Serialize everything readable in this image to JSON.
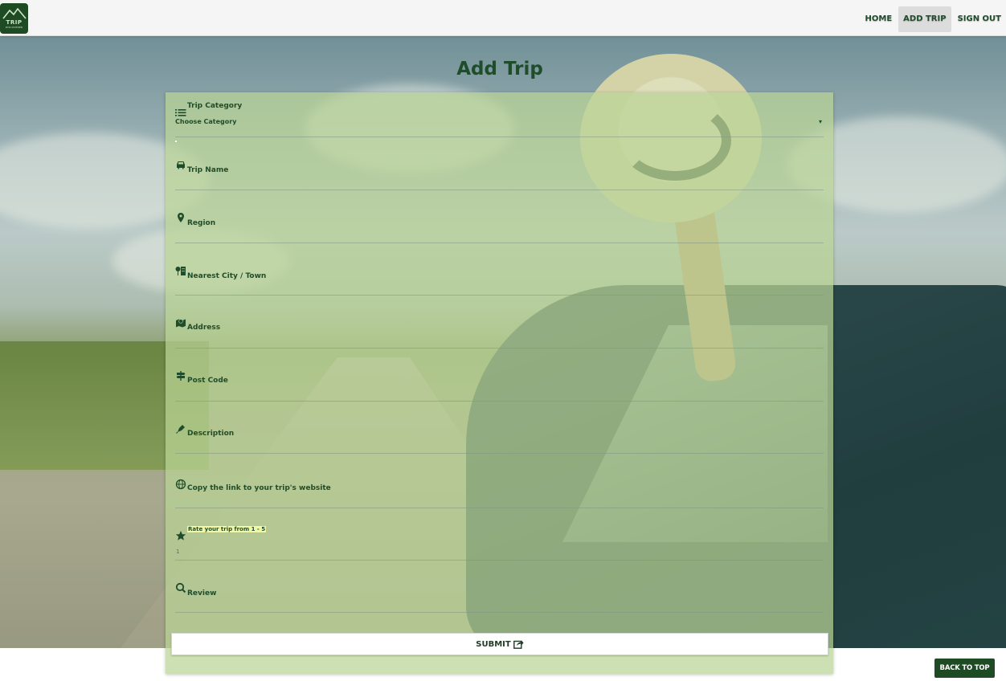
{
  "header": {
    "logo": {
      "text": "TRIP",
      "subtext": "DISCOVERER"
    },
    "nav": [
      {
        "label": "HOME"
      },
      {
        "label": "ADD TRIP",
        "active": true
      },
      {
        "label": "SIGN OUT"
      }
    ]
  },
  "page_title": "Add Trip",
  "form": {
    "category": {
      "label": "Trip Category",
      "selected": "Choose Category",
      "icon": "list-icon"
    },
    "fields": [
      {
        "label": "Trip Name",
        "icon": "car-icon"
      },
      {
        "label": "Region",
        "icon": "map-marker-icon"
      },
      {
        "label": "Nearest City / Town",
        "icon": "city-icon"
      },
      {
        "label": "Address",
        "icon": "map-icon"
      },
      {
        "label": "Post Code",
        "icon": "signpost-icon"
      },
      {
        "label": "Description",
        "icon": "pen-icon"
      },
      {
        "label": "Copy the link to your trip's website",
        "icon": "globe-icon"
      }
    ],
    "rating": {
      "label": "Rate your trip from 1 - 5",
      "value": "1",
      "icon": "star-icon"
    },
    "review": {
      "label": "Review",
      "icon": "search-icon"
    },
    "submit_label": "SUBMIT"
  },
  "footer": {
    "back_to_top": "BACK TO TOP"
  },
  "colors": {
    "brand": "#1e4a24",
    "text": "#1f4d2b",
    "card": "#bad496"
  }
}
